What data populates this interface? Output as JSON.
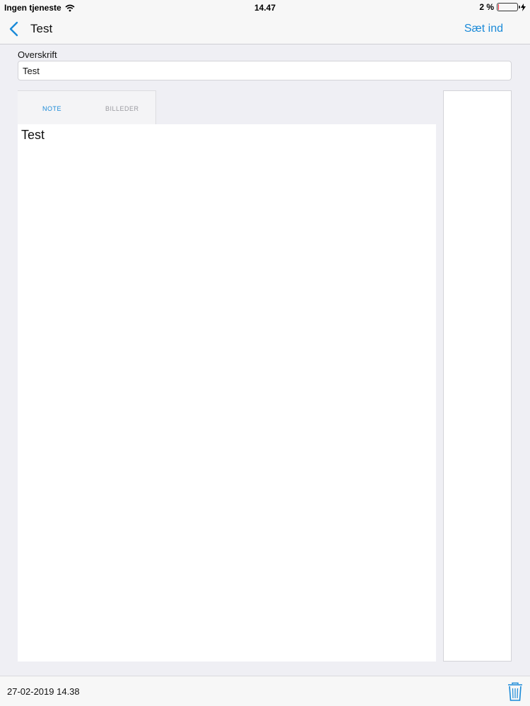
{
  "status_bar": {
    "carrier": "Ingen tjeneste",
    "time": "14.47",
    "battery": "2 %",
    "battery_level_percent": 2
  },
  "nav": {
    "back_icon": "chevron-left-icon",
    "title": "Test",
    "insert_label": "Sæt ind"
  },
  "heading": {
    "label": "Overskrift",
    "value": "Test"
  },
  "tabs": [
    {
      "label": "NOTE",
      "active": true
    },
    {
      "label": "BILLEDER",
      "active": false
    }
  ],
  "note": {
    "text": "Test"
  },
  "footer": {
    "date": "27-02-2019 14.38",
    "trash_icon": "trash-icon"
  },
  "colors": {
    "accent": "#1a8ad8",
    "background": "#efeff4",
    "bar": "#f7f7f7"
  }
}
